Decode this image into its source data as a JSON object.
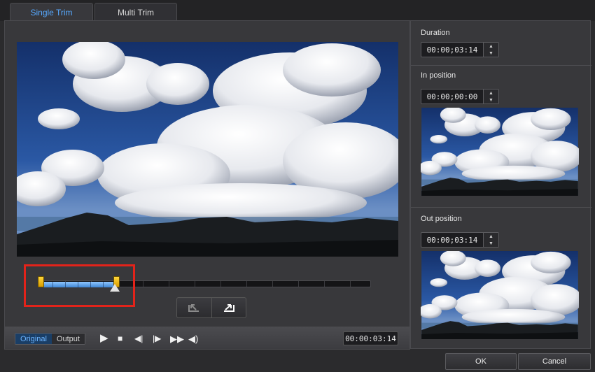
{
  "tabs": {
    "single": "Single Trim",
    "multi": "Multi Trim"
  },
  "trim": {
    "in_fraction": 0.0,
    "out_fraction": 0.23
  },
  "playback": {
    "original_label": "Original",
    "output_label": "Output",
    "timecode": "00:00:03:14"
  },
  "side": {
    "duration_label": "Duration",
    "duration_value": "00:00;03:14",
    "in_label": "In position",
    "in_value": "00:00;00:00",
    "out_label": "Out position",
    "out_value": "00:00;03:14"
  },
  "footer": {
    "ok": "OK",
    "cancel": "Cancel"
  },
  "icons": {
    "play": "play-icon",
    "stop": "stop-icon",
    "prev": "previous-frame-icon",
    "next": "next-frame-icon",
    "ff": "fast-forward-icon",
    "vol": "volume-icon",
    "mark_in": "mark-in-icon",
    "mark_out": "mark-out-icon"
  },
  "colors": {
    "accent": "#57a9ff",
    "handle": "#f2bd11",
    "highlight": "#e2231a"
  }
}
